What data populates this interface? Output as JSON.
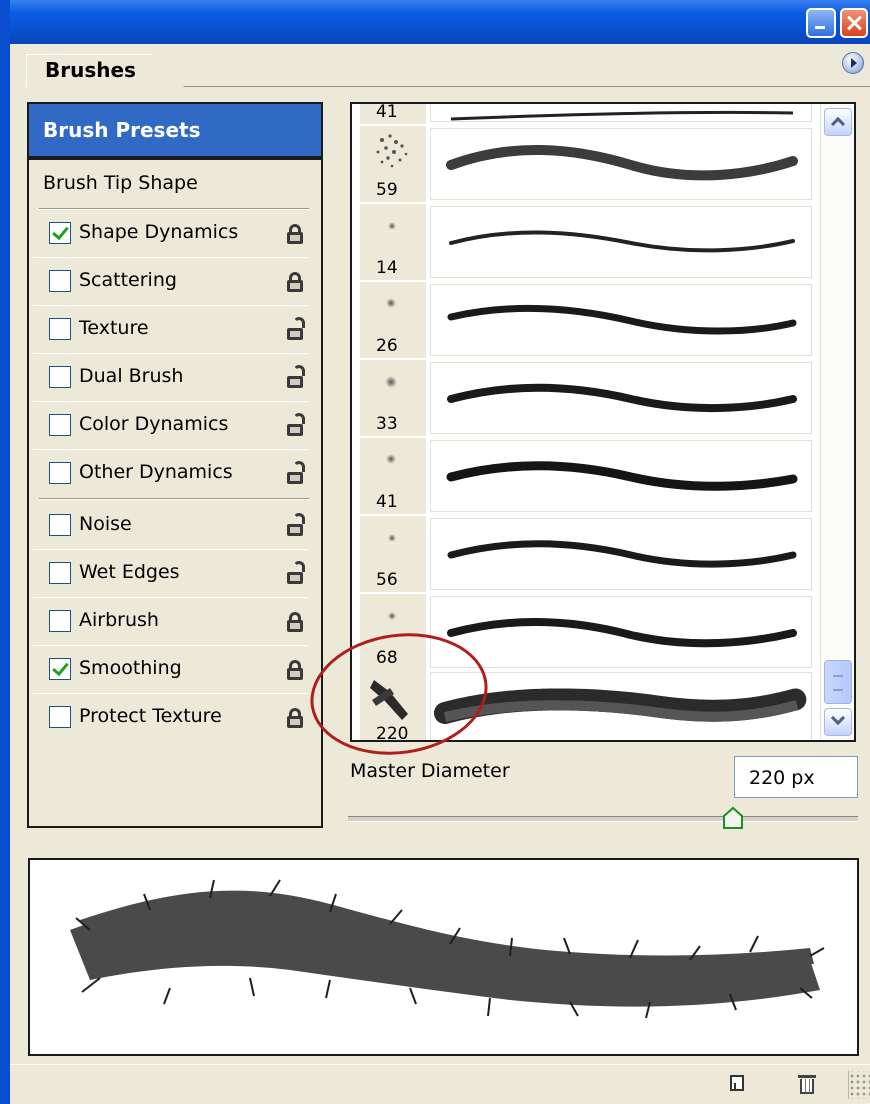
{
  "panel": {
    "tab_label": "Brushes",
    "presets_label": "Brush Presets",
    "tip_shape_label": "Brush Tip Shape",
    "options": [
      {
        "label": "Shape Dynamics",
        "checked": true,
        "locked": true
      },
      {
        "label": "Scattering",
        "checked": false,
        "locked": true
      },
      {
        "label": "Texture",
        "checked": false,
        "locked": false
      },
      {
        "label": "Dual Brush",
        "checked": false,
        "locked": false
      },
      {
        "label": "Color Dynamics",
        "checked": false,
        "locked": false
      },
      {
        "label": "Other Dynamics",
        "checked": false,
        "locked": false
      },
      {
        "label": "Noise",
        "checked": false,
        "locked": false
      },
      {
        "label": "Wet Edges",
        "checked": false,
        "locked": false
      },
      {
        "label": "Airbrush",
        "checked": false,
        "locked": true
      },
      {
        "label": "Smoothing",
        "checked": true,
        "locked": true
      },
      {
        "label": "Protect Texture",
        "checked": false,
        "locked": true
      }
    ]
  },
  "brushes": {
    "sizes": [
      "41",
      "59",
      "14",
      "26",
      "33",
      "41",
      "56",
      "68",
      "220"
    ],
    "selected": "220"
  },
  "master_diameter": {
    "label": "Master Diameter",
    "value": "220 px",
    "slider_fraction": 0.75
  },
  "colors": {
    "selection": "#316ac5",
    "annotation_circle": "#b11d1d",
    "titlebar": "#0a5ce0"
  },
  "icons": {
    "window_minimize": "minimize-icon",
    "window_close": "close-icon",
    "panel_menu": "flyout-menu-icon",
    "lock": "lock-icon",
    "new_preset": "new-brush-icon",
    "delete": "trash-icon"
  }
}
